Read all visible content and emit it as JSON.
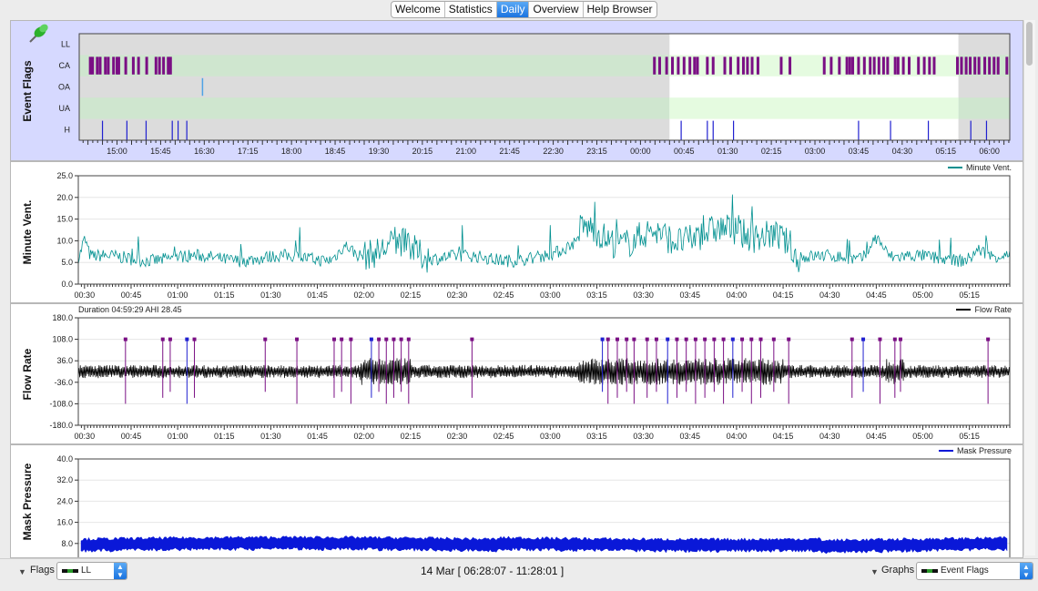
{
  "tabs": [
    {
      "label": "Welcome",
      "active": false
    },
    {
      "label": "Statistics",
      "active": false
    },
    {
      "label": "Daily",
      "active": true
    },
    {
      "label": "Overview",
      "active": false
    },
    {
      "label": "Help Browser",
      "active": false
    }
  ],
  "bottom": {
    "flags_label": "Flags",
    "flags_value": "LL",
    "date_range": "14 Mar [ 06:28:07 - 11:28:01 ]",
    "graphs_label": "Graphs",
    "graphs_value": "Event Flags"
  },
  "colors": {
    "accent": "#1a73e0",
    "ca": "#7a0f84",
    "oa": "#4ea3e6",
    "h": "#2020d0",
    "minute": "#009090",
    "flow": "#000000",
    "pressure": "#0a18d8",
    "event_flags_bg": "#d6d9ff"
  },
  "chart_data": [
    {
      "type": "event-flags",
      "title": "Event Flags",
      "icon": "pin-icon",
      "rows": [
        "LL",
        "CA",
        "OA",
        "UA",
        "H"
      ],
      "x_ticks": [
        "15:00",
        "15:45",
        "16:30",
        "17:15",
        "18:00",
        "18:45",
        "19:30",
        "20:15",
        "21:00",
        "21:45",
        "22:30",
        "23:15",
        "00:00",
        "00:45",
        "01:30",
        "02:15",
        "03:00",
        "03:45",
        "04:30",
        "05:15",
        "06:00"
      ],
      "x_range_hours": [
        14.35,
        30.35
      ],
      "session_hours": [
        0.5,
        5.4667
      ],
      "ca_hours": [
        14.54,
        14.58,
        14.66,
        14.71,
        14.8,
        14.85,
        14.94,
        15.0,
        15.03,
        15.15,
        15.28,
        15.37,
        15.51,
        15.67,
        15.73,
        15.8,
        15.88,
        15.92,
        24.24,
        24.33,
        24.45,
        24.55,
        24.65,
        24.75,
        24.85,
        24.93,
        24.98,
        25.15,
        25.25,
        25.45,
        25.55,
        25.68,
        25.77,
        25.84,
        25.92,
        26.02,
        26.42,
        26.57,
        27.16,
        27.28,
        27.42,
        27.55,
        27.6,
        27.65,
        27.75,
        27.85,
        27.95,
        28.02,
        28.1,
        28.18,
        28.25,
        28.38,
        28.43,
        28.52,
        28.62,
        28.78,
        28.88,
        28.97,
        29.05,
        29.45,
        29.52,
        29.6,
        29.67,
        29.75,
        29.82,
        29.92,
        30.0,
        30.08,
        30.15,
        30.3
      ],
      "oa_hours": [
        16.47
      ],
      "h_hours": [
        14.75,
        15.17,
        15.5,
        15.95,
        16.05,
        16.2,
        24.7,
        25.15,
        25.25,
        25.6,
        27.75,
        28.3,
        28.95,
        29.68,
        29.95
      ],
      "ylabel": "Event Flags"
    },
    {
      "type": "line",
      "title": "Minute Vent.",
      "series": [
        {
          "name": "Minute Vent."
        }
      ],
      "y_ticks": [
        "25.0",
        "20.0",
        "15.0",
        "10.0",
        "5.0",
        "0.0"
      ],
      "ylim": [
        0,
        25
      ],
      "x_ticks": [
        "00:30",
        "00:45",
        "01:00",
        "01:15",
        "01:30",
        "01:45",
        "02:00",
        "02:15",
        "02:30",
        "02:45",
        "03:00",
        "03:15",
        "03:30",
        "03:45",
        "04:00",
        "04:15",
        "04:30",
        "04:45",
        "05:00",
        "05:15"
      ],
      "x_range_hours": [
        0.4667,
        5.4667
      ],
      "ylabel": "Minute Vent."
    },
    {
      "type": "line",
      "title": "Flow Rate",
      "duration_label": "Duration 04:59:29 AHI 28.45",
      "series": [
        {
          "name": "Flow Rate"
        }
      ],
      "y_ticks": [
        "180.0",
        "108.0",
        "36.0",
        "-36.0",
        "-108.0",
        "-180.0"
      ],
      "ylim": [
        -180,
        180
      ],
      "x_ticks": [
        "00:30",
        "00:45",
        "01:00",
        "01:15",
        "01:30",
        "01:45",
        "02:00",
        "02:15",
        "02:30",
        "02:45",
        "03:00",
        "03:15",
        "03:30",
        "03:45",
        "04:00",
        "04:15",
        "04:30",
        "04:45",
        "05:00",
        "05:15"
      ],
      "x_range_hours": [
        0.4667,
        5.4667
      ],
      "ylabel": "Flow Rate"
    },
    {
      "type": "line",
      "title": "Mask Pressure",
      "series": [
        {
          "name": "Mask Pressure"
        }
      ],
      "y_ticks": [
        "40.0",
        "32.0",
        "24.0",
        "16.0",
        "8.0"
      ],
      "ylim": [
        0,
        40
      ],
      "ylabel": "Mask Pressure"
    }
  ]
}
